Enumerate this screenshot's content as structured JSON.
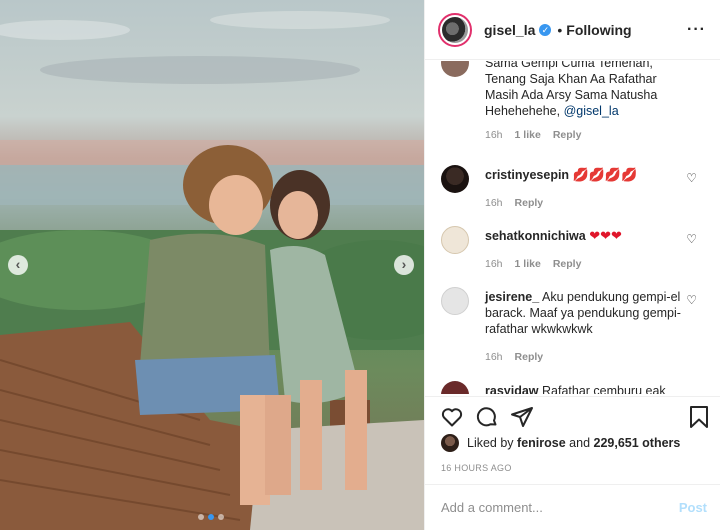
{
  "post": {
    "carousel": {
      "dots": 3,
      "active_dot": 1
    },
    "icons": {
      "prev": "chevron-left-icon",
      "next": "chevron-right-icon"
    }
  },
  "header": {
    "username": "gisel_la",
    "verified_icon": "verified-badge-icon",
    "separator": "•",
    "follow_status": "Following",
    "more_label": "···"
  },
  "caption_fragment": {
    "text": "Sama Gempi Cuma Temenan, Tenang Saja Khan Aa Rafathar Masih Ada Arsy Sama Natusha Hehehehehe,",
    "mention": "@gisel_la",
    "time": "16h",
    "likes": "1 like",
    "reply": "Reply"
  },
  "comments": [
    {
      "username": "cristinyesepin",
      "text": "💋💋💋💋",
      "time": "16h",
      "likes": "",
      "reply": "Reply"
    },
    {
      "username": "sehatkonnichiwa",
      "text": "❤❤❤",
      "time": "16h",
      "likes": "1 like",
      "reply": "Reply"
    },
    {
      "username": "jesirene_",
      "text": "Aku pendukung gempi-el barack. Maaf ya pendukung gempi-rafathar wkwkwkwk",
      "time": "16h",
      "likes": "",
      "reply": "Reply"
    },
    {
      "username": "rasyidaw",
      "text": "Rafathar cemburu eak",
      "time": "",
      "likes": "",
      "reply": ""
    }
  ],
  "actions": {
    "like_icon": "heart-icon",
    "comment_icon": "comment-icon",
    "share_icon": "share-icon",
    "save_icon": "bookmark-icon"
  },
  "likes": {
    "prefix": "Liked by",
    "user": "fenirose",
    "and": "and",
    "count": "229,651 others"
  },
  "time_ago": "16 HOURS AGO",
  "add_comment": {
    "placeholder": "Add a comment...",
    "post_label": "Post"
  },
  "colors": {
    "accent": "#3897f0",
    "post_disabled": "#b2dffc",
    "heart": "#e0162b",
    "meta": "#8e8e8e"
  }
}
